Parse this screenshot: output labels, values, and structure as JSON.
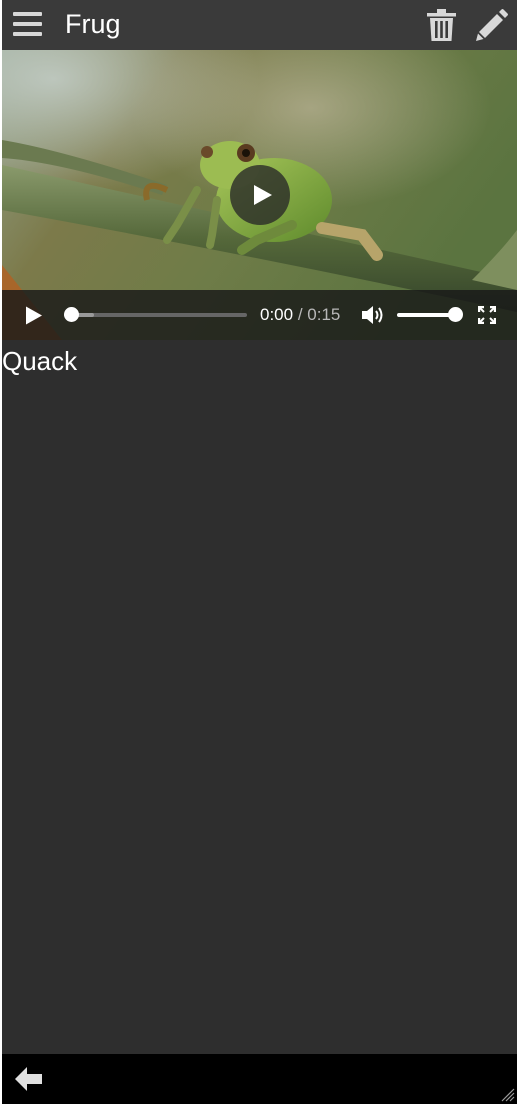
{
  "header": {
    "title": "Frug",
    "menu_icon": "hamburger-menu-icon",
    "delete_icon": "trash-icon",
    "edit_icon": "pencil-icon"
  },
  "video": {
    "current_time": "0:00",
    "separator": " / ",
    "duration": "0:15",
    "progress_fraction": 0.0,
    "volume_fraction": 1.0,
    "icons": [
      "play-icon",
      "volume-icon",
      "fullscreen-icon"
    ]
  },
  "content": {
    "caption": "Quack"
  },
  "footer": {
    "back_icon": "back-arrow-icon"
  },
  "colors": {
    "background": "#2e2e2e",
    "header": "#3a3a3a",
    "footer": "#000000",
    "text": "#ffffff"
  }
}
